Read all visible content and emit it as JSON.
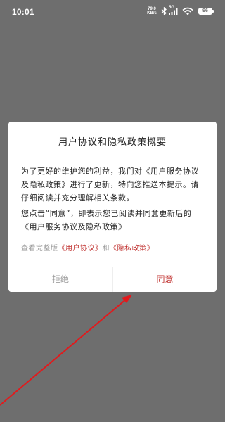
{
  "status_bar": {
    "time": "10:01",
    "net_speed_value": "79.0",
    "net_speed_unit": "KB/s",
    "signal_label": "5G",
    "battery_level": "96"
  },
  "dialog": {
    "title": "用户协议和隐私政策概要",
    "para1": "为了更好的维护您的利益，我们对《用户服务协议及隐私政策》进行了更新，特向您推送本提示。请仔细阅读并充分理解相关条款。",
    "para2": "您点击“同意”，即表示您已阅读并同意更新后的 《用户服务协议及隐私政策》",
    "links_prefix": "查看完整版",
    "user_agreement_link": "《用户协议》",
    "links_joiner": "和",
    "privacy_policy_link": "《隐私政策》",
    "reject_label": "拒绝",
    "agree_label": "同意"
  },
  "colors": {
    "backdrop": "#6e6e6e",
    "accent": "#c0312f",
    "muted_text": "#a0a0a0"
  }
}
